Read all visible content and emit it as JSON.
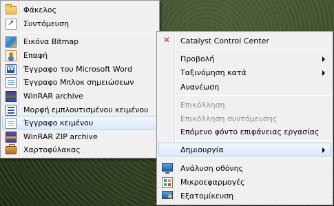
{
  "new_submenu": {
    "items": [
      {
        "label": "Φάκελος",
        "icon": "folder-icon"
      },
      {
        "label": "Συντόμευση",
        "icon": "shortcut-icon"
      },
      {
        "label": "Εικόνα Bitmap",
        "icon": "bitmap-image-icon"
      },
      {
        "label": "Επαφή",
        "icon": "contact-icon"
      },
      {
        "label": "Έγγραφο του Microsoft Word",
        "icon": "word-document-icon"
      },
      {
        "label": "Έγγραφο Μπλοκ σημειώσεων",
        "icon": "journal-document-icon"
      },
      {
        "label": "WinRAR archive",
        "icon": "winrar-archive-icon"
      },
      {
        "label": "Μορφή εμπλουτισμένου κειμένου",
        "icon": "rich-text-document-icon"
      },
      {
        "label": "Έγγραφο κειμένου",
        "icon": "text-document-icon",
        "highlighted": true
      },
      {
        "label": "WinRAR ZIP archive",
        "icon": "winrar-zip-icon"
      },
      {
        "label": "Χαρτοφύλακας",
        "icon": "briefcase-icon"
      }
    ]
  },
  "desktop_menu": {
    "items": [
      {
        "label": "Catalyst Control Center",
        "icon": "catalyst-control-center-icon"
      },
      {
        "label": "Προβολή",
        "has_submenu": true
      },
      {
        "label": "Ταξινόμηση κατά",
        "has_submenu": true
      },
      {
        "label": "Ανανέωση"
      },
      {
        "label": "Επικόλληση",
        "disabled": true
      },
      {
        "label": "Επικόλληση συντόμευσης",
        "disabled": true
      },
      {
        "label": "Επόμενο φόντο επιφάνειας εργασίας"
      },
      {
        "label": "Δημιουργία",
        "has_submenu": true,
        "highlighted": true
      },
      {
        "label": "Ανάλυση οθόνης",
        "icon": "screen-resolution-icon"
      },
      {
        "label": "Μικροεφαρμογές",
        "icon": "gadgets-icon"
      },
      {
        "label": "Εξατομίκευση",
        "icon": "personalize-icon"
      }
    ]
  },
  "colors": {
    "menu_bg": "#f0f0f0",
    "menu_border": "#979797",
    "highlight_bg": "#dceafb",
    "highlight_border": "#aecff7",
    "disabled_text": "#8d8d8d"
  }
}
